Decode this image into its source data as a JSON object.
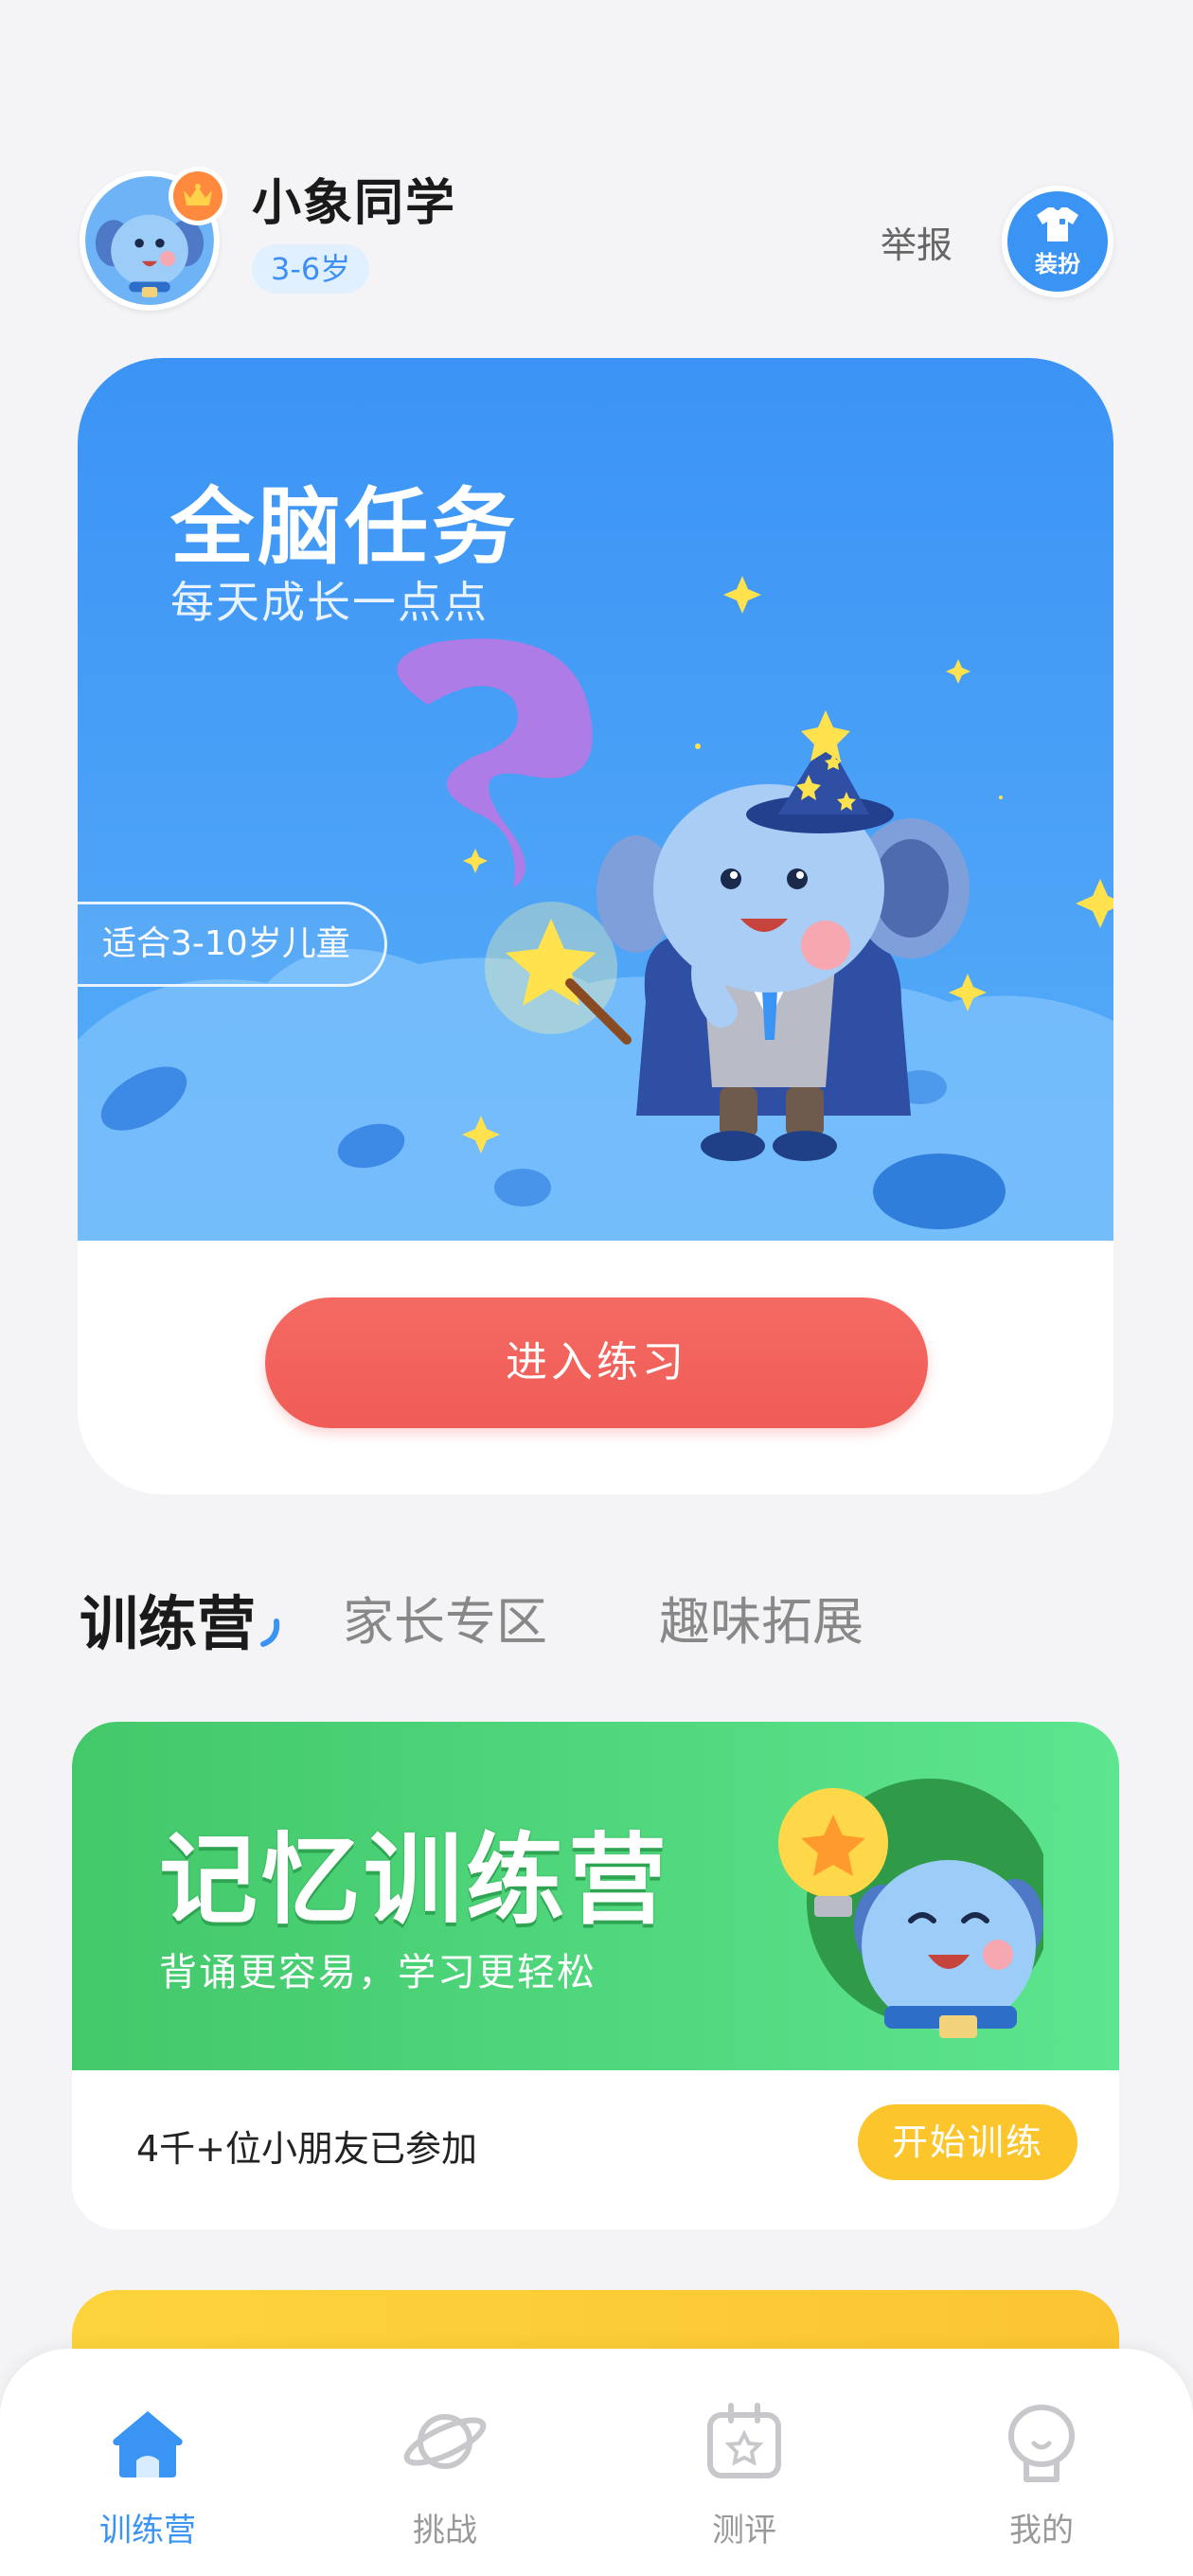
{
  "user": {
    "name": "小象同学",
    "age_range": "3-6岁"
  },
  "header": {
    "report_label": "举报",
    "dressup_label": "装扮"
  },
  "hero": {
    "title": "全脑任务",
    "subtitle": "每天成长一点点",
    "tag": "适合3-10岁儿童",
    "button_label": "进入练习"
  },
  "tabs": [
    {
      "label": "训练营",
      "active": true
    },
    {
      "label": "家长专区",
      "active": false
    },
    {
      "label": "趣味拓展",
      "active": false
    }
  ],
  "camp": {
    "title": "记忆训练营",
    "subtitle": "背诵更容易，学习更轻松",
    "participants": "4千+位小朋友已参加",
    "button_label": "开始训练"
  },
  "bottom_nav": [
    {
      "label": "训练营",
      "icon": "home-icon",
      "active": true
    },
    {
      "label": "挑战",
      "icon": "planet-icon",
      "active": false
    },
    {
      "label": "测评",
      "icon": "assessment-icon",
      "active": false
    },
    {
      "label": "我的",
      "icon": "profile-icon",
      "active": false
    }
  ],
  "colors": {
    "primary_blue": "#3a94f3",
    "hero_gradient_top": "#3b93f5",
    "enter_button": "#f05c56",
    "camp_green": "#43c86a",
    "start_yellow": "#fcc52b",
    "background": "#f4f4f6"
  }
}
